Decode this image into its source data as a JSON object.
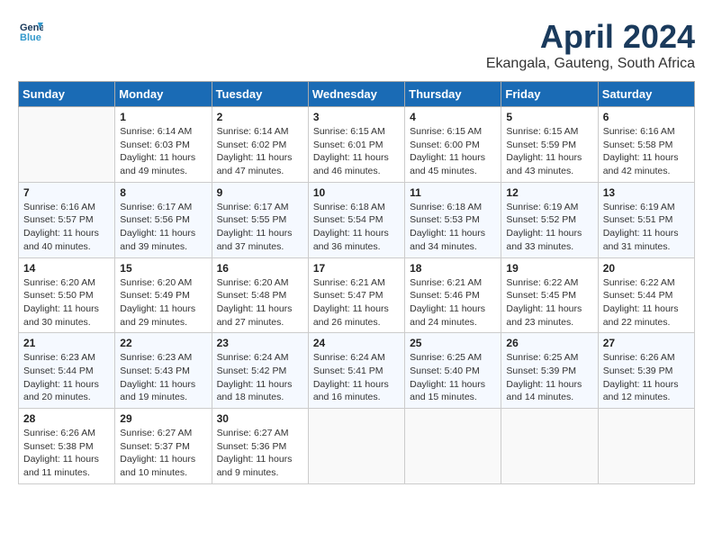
{
  "header": {
    "logo_line1": "General",
    "logo_line2": "Blue",
    "month": "April 2024",
    "location": "Ekangala, Gauteng, South Africa"
  },
  "days_of_week": [
    "Sunday",
    "Monday",
    "Tuesday",
    "Wednesday",
    "Thursday",
    "Friday",
    "Saturday"
  ],
  "weeks": [
    [
      {
        "day": "",
        "sunrise": "",
        "sunset": "",
        "daylight": ""
      },
      {
        "day": "1",
        "sunrise": "Sunrise: 6:14 AM",
        "sunset": "Sunset: 6:03 PM",
        "daylight": "Daylight: 11 hours and 49 minutes."
      },
      {
        "day": "2",
        "sunrise": "Sunrise: 6:14 AM",
        "sunset": "Sunset: 6:02 PM",
        "daylight": "Daylight: 11 hours and 47 minutes."
      },
      {
        "day": "3",
        "sunrise": "Sunrise: 6:15 AM",
        "sunset": "Sunset: 6:01 PM",
        "daylight": "Daylight: 11 hours and 46 minutes."
      },
      {
        "day": "4",
        "sunrise": "Sunrise: 6:15 AM",
        "sunset": "Sunset: 6:00 PM",
        "daylight": "Daylight: 11 hours and 45 minutes."
      },
      {
        "day": "5",
        "sunrise": "Sunrise: 6:15 AM",
        "sunset": "Sunset: 5:59 PM",
        "daylight": "Daylight: 11 hours and 43 minutes."
      },
      {
        "day": "6",
        "sunrise": "Sunrise: 6:16 AM",
        "sunset": "Sunset: 5:58 PM",
        "daylight": "Daylight: 11 hours and 42 minutes."
      }
    ],
    [
      {
        "day": "7",
        "sunrise": "Sunrise: 6:16 AM",
        "sunset": "Sunset: 5:57 PM",
        "daylight": "Daylight: 11 hours and 40 minutes."
      },
      {
        "day": "8",
        "sunrise": "Sunrise: 6:17 AM",
        "sunset": "Sunset: 5:56 PM",
        "daylight": "Daylight: 11 hours and 39 minutes."
      },
      {
        "day": "9",
        "sunrise": "Sunrise: 6:17 AM",
        "sunset": "Sunset: 5:55 PM",
        "daylight": "Daylight: 11 hours and 37 minutes."
      },
      {
        "day": "10",
        "sunrise": "Sunrise: 6:18 AM",
        "sunset": "Sunset: 5:54 PM",
        "daylight": "Daylight: 11 hours and 36 minutes."
      },
      {
        "day": "11",
        "sunrise": "Sunrise: 6:18 AM",
        "sunset": "Sunset: 5:53 PM",
        "daylight": "Daylight: 11 hours and 34 minutes."
      },
      {
        "day": "12",
        "sunrise": "Sunrise: 6:19 AM",
        "sunset": "Sunset: 5:52 PM",
        "daylight": "Daylight: 11 hours and 33 minutes."
      },
      {
        "day": "13",
        "sunrise": "Sunrise: 6:19 AM",
        "sunset": "Sunset: 5:51 PM",
        "daylight": "Daylight: 11 hours and 31 minutes."
      }
    ],
    [
      {
        "day": "14",
        "sunrise": "Sunrise: 6:20 AM",
        "sunset": "Sunset: 5:50 PM",
        "daylight": "Daylight: 11 hours and 30 minutes."
      },
      {
        "day": "15",
        "sunrise": "Sunrise: 6:20 AM",
        "sunset": "Sunset: 5:49 PM",
        "daylight": "Daylight: 11 hours and 29 minutes."
      },
      {
        "day": "16",
        "sunrise": "Sunrise: 6:20 AM",
        "sunset": "Sunset: 5:48 PM",
        "daylight": "Daylight: 11 hours and 27 minutes."
      },
      {
        "day": "17",
        "sunrise": "Sunrise: 6:21 AM",
        "sunset": "Sunset: 5:47 PM",
        "daylight": "Daylight: 11 hours and 26 minutes."
      },
      {
        "day": "18",
        "sunrise": "Sunrise: 6:21 AM",
        "sunset": "Sunset: 5:46 PM",
        "daylight": "Daylight: 11 hours and 24 minutes."
      },
      {
        "day": "19",
        "sunrise": "Sunrise: 6:22 AM",
        "sunset": "Sunset: 5:45 PM",
        "daylight": "Daylight: 11 hours and 23 minutes."
      },
      {
        "day": "20",
        "sunrise": "Sunrise: 6:22 AM",
        "sunset": "Sunset: 5:44 PM",
        "daylight": "Daylight: 11 hours and 22 minutes."
      }
    ],
    [
      {
        "day": "21",
        "sunrise": "Sunrise: 6:23 AM",
        "sunset": "Sunset: 5:44 PM",
        "daylight": "Daylight: 11 hours and 20 minutes."
      },
      {
        "day": "22",
        "sunrise": "Sunrise: 6:23 AM",
        "sunset": "Sunset: 5:43 PM",
        "daylight": "Daylight: 11 hours and 19 minutes."
      },
      {
        "day": "23",
        "sunrise": "Sunrise: 6:24 AM",
        "sunset": "Sunset: 5:42 PM",
        "daylight": "Daylight: 11 hours and 18 minutes."
      },
      {
        "day": "24",
        "sunrise": "Sunrise: 6:24 AM",
        "sunset": "Sunset: 5:41 PM",
        "daylight": "Daylight: 11 hours and 16 minutes."
      },
      {
        "day": "25",
        "sunrise": "Sunrise: 6:25 AM",
        "sunset": "Sunset: 5:40 PM",
        "daylight": "Daylight: 11 hours and 15 minutes."
      },
      {
        "day": "26",
        "sunrise": "Sunrise: 6:25 AM",
        "sunset": "Sunset: 5:39 PM",
        "daylight": "Daylight: 11 hours and 14 minutes."
      },
      {
        "day": "27",
        "sunrise": "Sunrise: 6:26 AM",
        "sunset": "Sunset: 5:39 PM",
        "daylight": "Daylight: 11 hours and 12 minutes."
      }
    ],
    [
      {
        "day": "28",
        "sunrise": "Sunrise: 6:26 AM",
        "sunset": "Sunset: 5:38 PM",
        "daylight": "Daylight: 11 hours and 11 minutes."
      },
      {
        "day": "29",
        "sunrise": "Sunrise: 6:27 AM",
        "sunset": "Sunset: 5:37 PM",
        "daylight": "Daylight: 11 hours and 10 minutes."
      },
      {
        "day": "30",
        "sunrise": "Sunrise: 6:27 AM",
        "sunset": "Sunset: 5:36 PM",
        "daylight": "Daylight: 11 hours and 9 minutes."
      },
      {
        "day": "",
        "sunrise": "",
        "sunset": "",
        "daylight": ""
      },
      {
        "day": "",
        "sunrise": "",
        "sunset": "",
        "daylight": ""
      },
      {
        "day": "",
        "sunrise": "",
        "sunset": "",
        "daylight": ""
      },
      {
        "day": "",
        "sunrise": "",
        "sunset": "",
        "daylight": ""
      }
    ]
  ]
}
